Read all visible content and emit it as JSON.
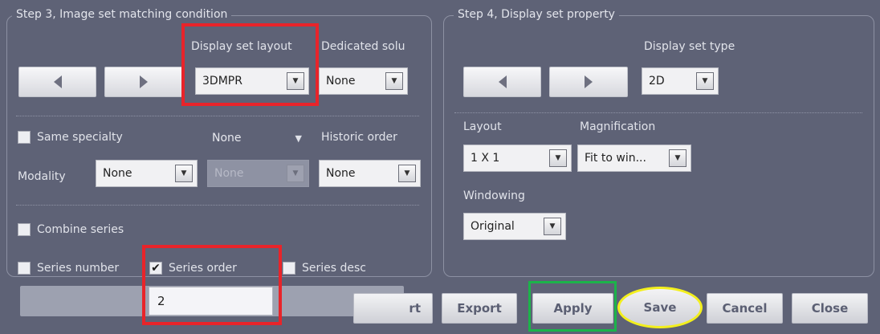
{
  "step3": {
    "title": "Step 3, Image set matching condition",
    "display_set_layout_label": "Display set layout",
    "dedicated_label": "Dedicated solu",
    "layout_value": "3DMPR",
    "dedicated_value": "None",
    "same_specialty_label": "Same specialty",
    "same_specialty_value": "None",
    "historic_order_label": "Historic order",
    "modality_label": "Modality",
    "modality_value": "None",
    "modality2_value": "None",
    "historic_value": "None",
    "combine_series_label": "Combine series",
    "series_number_label": "Series number",
    "series_order_label": "Series order",
    "series_order_checked": true,
    "series_desc_label": "Series desc",
    "series_order_value": "2"
  },
  "step4": {
    "title": "Step 4, Display set property",
    "display_set_type_label": "Display set type",
    "type_value": "2D",
    "layout_label": "Layout",
    "layout_value": "1 X 1",
    "magnification_label": "Magnification",
    "magnification_value": "Fit to win...",
    "windowing_label": "Windowing",
    "windowing_value": "Original"
  },
  "buttons": {
    "import_partial": "rt",
    "export": "Export",
    "apply": "Apply",
    "save": "Save",
    "cancel": "Cancel",
    "close": "Close"
  },
  "icons": {
    "prev": "triangle-left-icon",
    "next": "triangle-right-icon",
    "dropdown": "chevron-down-icon",
    "check": "checkmark-icon"
  },
  "highlights": {
    "red": "#e8242a",
    "green": "#1cb34a",
    "yellow": "#f3ef1d"
  }
}
